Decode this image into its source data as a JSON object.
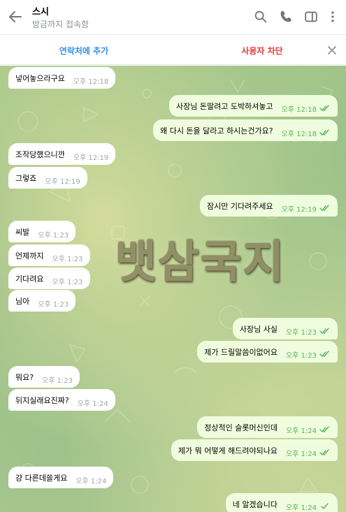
{
  "header": {
    "title": "스시",
    "status": "방금까지 접속함",
    "icons": [
      "back-arrow-icon",
      "search-icon",
      "phone-icon",
      "sidebar-panel-icon",
      "more-vertical-icon"
    ]
  },
  "actionbar": {
    "add_contact": "연락처에 추가",
    "block_user": "사용자 차단",
    "close_icon": "close-icon"
  },
  "watermark": "뱃삼국지",
  "messages": [
    {
      "dir": "in",
      "text": "넣어놓으라구요",
      "time": "오후 12:18"
    },
    {
      "dir": "out",
      "text": "사장님 돈딸려고 도박하셔놓고",
      "time": "오후 12:18",
      "read": true
    },
    {
      "dir": "out",
      "text": "왜 다시 돈을 달라고 하시는건가요?",
      "time": "오후 12:18",
      "read": true
    },
    {
      "dir": "in",
      "text": "조작당했으니깐",
      "time": "오후 12:19"
    },
    {
      "dir": "in",
      "text": "그렇죠",
      "time": "오후 12:19"
    },
    {
      "dir": "out",
      "text": "잠시만 기다려주세요",
      "time": "오후 12:19",
      "read": true
    },
    {
      "dir": "in",
      "text": "씨발",
      "time": "오후 1:23"
    },
    {
      "dir": "in",
      "text": "언제까지",
      "time": "오후 1:23"
    },
    {
      "dir": "in",
      "text": "기다려요",
      "time": "오후 1:23"
    },
    {
      "dir": "in",
      "text": "님아",
      "time": "오후 1:23"
    },
    {
      "dir": "out",
      "text": "사장님 사실",
      "time": "오후 1:23",
      "read": true
    },
    {
      "dir": "out",
      "text": "제가 드릴말씀이없어요",
      "time": "오후 1:23",
      "read": true
    },
    {
      "dir": "in",
      "text": "뭐요?",
      "time": "오후 1:23"
    },
    {
      "dir": "in",
      "text": "뒤지실래요진짜?",
      "time": "오후 1:24"
    },
    {
      "dir": "out",
      "text": "정상적인 슬롯머신인데",
      "time": "오후 1:24",
      "read": true
    },
    {
      "dir": "out",
      "text": "제가 뭐 어떻게 해드려야되나요",
      "time": "오후 1:24",
      "read": true
    },
    {
      "dir": "in",
      "text": "걍 다른데쓸게요",
      "time": "오후 1:24"
    },
    {
      "dir": "out",
      "text": "네 알겠습니다",
      "time": "오후 1:24",
      "read": false
    }
  ],
  "colors": {
    "accent": "#3390ec",
    "danger": "#e53935",
    "outgoing_bubble": "#effdde",
    "check": "#56b45a"
  }
}
